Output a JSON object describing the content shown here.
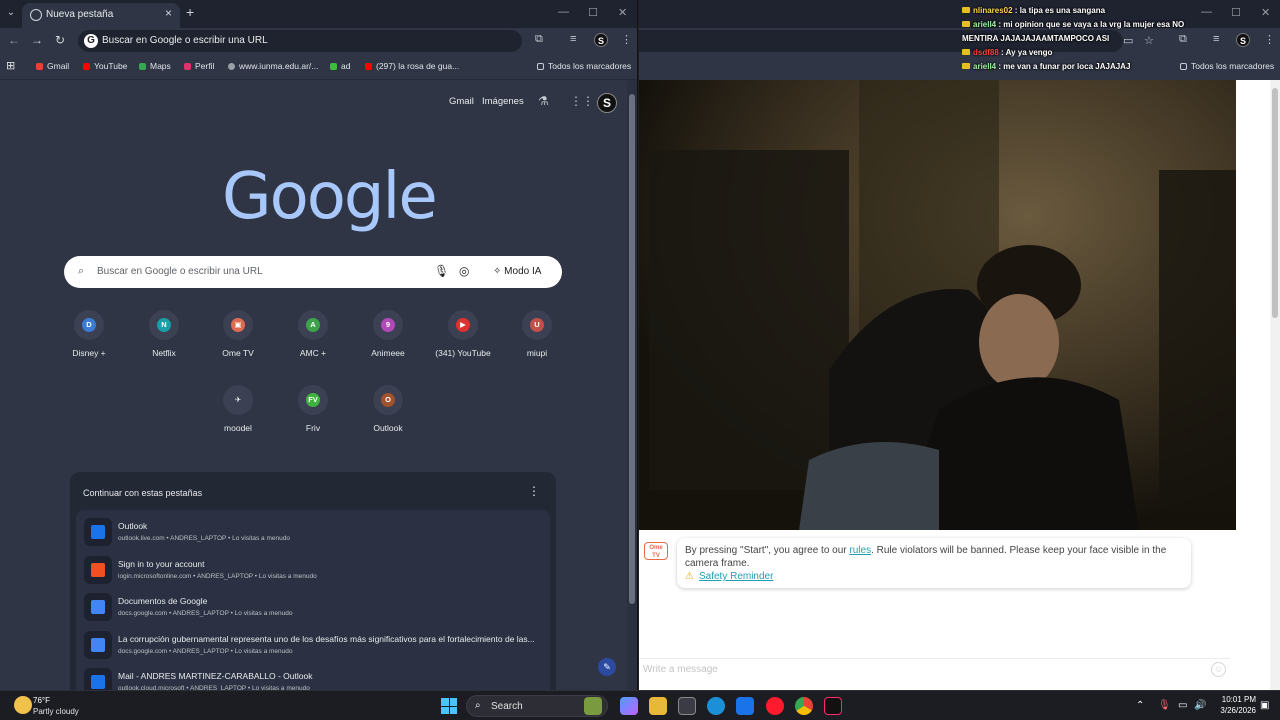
{
  "left_window": {
    "tab": {
      "title": "Nueva pestaña"
    },
    "omnibox": {
      "text": "Buscar en Google o escribir una URL"
    },
    "bookmarks": [
      {
        "label": "Gmail",
        "icon": "gmail-icon",
        "color": "#ea4335"
      },
      {
        "label": "YouTube",
        "icon": "youtube-icon",
        "color": "#ff0000"
      },
      {
        "label": "Maps",
        "icon": "maps-icon",
        "color": "#34a853"
      },
      {
        "label": "Perfil",
        "icon": "instagram-icon",
        "color": "#e1306c"
      },
      {
        "label": "www.iunma.edu.ar/...",
        "icon": "globe-icon",
        "color": "#9aa0a6"
      },
      {
        "label": "ad",
        "icon": "ad-icon",
        "color": "#3dbb3d"
      },
      {
        "label": "(297) la rosa de gua...",
        "icon": "youtube-icon",
        "color": "#ff0000"
      }
    ],
    "all_bookmarks": "Todos los marcadores",
    "ntp": {
      "gmail": "Gmail",
      "images": "Imágenes",
      "logo": "Google",
      "search_placeholder": "Buscar en Google o escribir una URL",
      "ai_mode": "Modo IA",
      "shortcuts": [
        {
          "label": "Disney +",
          "glyph": "D",
          "color": "#3b7bd4"
        },
        {
          "label": "Netflix",
          "glyph": "N",
          "color": "#1a9fa8"
        },
        {
          "label": "Ome TV",
          "glyph": "▣",
          "color": "#e06a4f"
        },
        {
          "label": "AMC +",
          "glyph": "A",
          "color": "#3ca34a"
        },
        {
          "label": "Animeee",
          "glyph": "9",
          "color": "#b048b8"
        },
        {
          "label": "(341) YouTube",
          "glyph": "▶",
          "color": "#e03030"
        },
        {
          "label": "miupi",
          "glyph": "U",
          "color": "#c0504a"
        },
        {
          "label": "moodel",
          "glyph": "✈",
          "color": "#3b4152"
        },
        {
          "label": "Friv",
          "glyph": "FV",
          "color": "#3fb23f"
        },
        {
          "label": "Outlook",
          "glyph": "O",
          "color": "#a0522d"
        }
      ],
      "continue": {
        "title": "Continuar con estas pestañas",
        "items": [
          {
            "title": "Outlook",
            "sub": "outlook.live.com • ANDRES_LAPTOP • Lo visitas a menudo",
            "icon": "outlook-icon",
            "color": "#1a73e8"
          },
          {
            "title": "Sign in to your account",
            "sub": "login.microsoftonline.com • ANDRES_LAPTOP • Lo visitas a menudo",
            "icon": "microsoft-icon",
            "color": "#f25022"
          },
          {
            "title": "Documentos de Google",
            "sub": "docs.google.com • ANDRES_LAPTOP • Lo visitas a menudo",
            "icon": "docs-icon",
            "color": "#4285f4"
          },
          {
            "title": "La corrupción gubernamental representa uno de los desafíos más significativos para el fortalecimiento de las...",
            "sub": "docs.google.com • ANDRES_LAPTOP • Lo visitas a menudo",
            "icon": "docs-icon",
            "color": "#4285f4"
          },
          {
            "title": "Mail - ANDRES MARTINEZ-CARABALLO - Outlook",
            "sub": "outlook.cloud.microsoft • ANDRES_LAPTOP • Lo visitas a menudo",
            "icon": "outlook-icon",
            "color": "#1a73e8"
          }
        ]
      }
    }
  },
  "right_window": {
    "all_bookmarks": "Todos los marcadores",
    "notice": {
      "before": "By pressing \"Start\", you agree to our ",
      "link": "rules",
      "after": ". Rule violators will be banned. Please keep your face visible in the camera frame.",
      "safety": "Safety Reminder",
      "logo_text": "Ome TV"
    },
    "message_placeholder": "Write a message"
  },
  "chat": [
    {
      "user": "nlinares02",
      "text": "la tipa es una sangana",
      "color": "#ffd84a"
    },
    {
      "user": "ariell4",
      "text": "mi opinion que se vaya a la vrg la mujer esa NO MENTIRA JAJAJAJAAMTAMPOCO ASI",
      "color": "#9ef0a0"
    },
    {
      "user": "dsdf88",
      "text": "Ay ya vengo",
      "color": "#ff4040"
    },
    {
      "user": "ariell4",
      "text": "me van a funar por loca JAJAJAJ",
      "color": "#9ef0a0"
    }
  ],
  "taskbar": {
    "temp": "76°F",
    "weather": "Partly cloudy",
    "search": "Search",
    "time": "10:01 PM",
    "date": "3/26/2026"
  }
}
